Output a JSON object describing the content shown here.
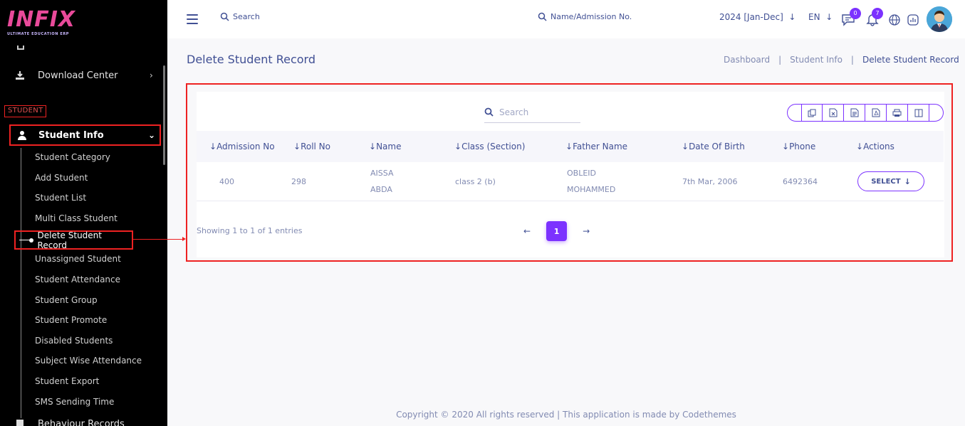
{
  "brand": {
    "logo_text": "INFIX",
    "logo_tagline": "ULTIMATE EDUCATION ERP"
  },
  "sidebar": {
    "download_center": "Download Center",
    "section_label": "STUDENT",
    "active_item": "Student Info",
    "sub_items": [
      "Student Category",
      "Add Student",
      "Student List",
      "Multi Class Student",
      "Delete Student Record",
      "Unassigned Student",
      "Student Attendance",
      "Student Group",
      "Student Promote",
      "Disabled Students",
      "Subject Wise Attendance",
      "Student Export",
      "SMS Sending Time"
    ],
    "bottom_item": "Behaviour Records"
  },
  "topbar": {
    "search_label": "Search",
    "search2_label": "Name/Admission No.",
    "academic_year": "2024 [Jan-Dec]",
    "language": "EN",
    "chat_badge": "0",
    "notification_badge": "7"
  },
  "page": {
    "title": "Delete Student Record",
    "breadcrumb": [
      "Dashboard",
      "Student Info",
      "Delete Student Record"
    ]
  },
  "table": {
    "search_placeholder": "Search",
    "columns": [
      "Admission No",
      "Roll No",
      "Name",
      "Class (Section)",
      "Father Name",
      "Date Of Birth",
      "Phone",
      "Actions"
    ],
    "rows": [
      {
        "admission_no": "400",
        "roll_no": "298",
        "name_line1": "AISSA",
        "name_line2": "ABDA",
        "class_section": "class 2 (b)",
        "father_line1": "OBLEID",
        "father_line2": "MOHAMMED",
        "dob": "7th Mar, 2006",
        "phone": "6492364",
        "action_label": "SELECT"
      }
    ],
    "showing": "Showing 1 to 1 of 1 entries",
    "current_page": "1"
  },
  "footer": {
    "text": "Copyright © 2020 All rights reserved | This application is made by Codethemes"
  },
  "colors": {
    "accent": "#7c32ff",
    "primary_text": "#415094",
    "highlight": "#ee2222"
  }
}
